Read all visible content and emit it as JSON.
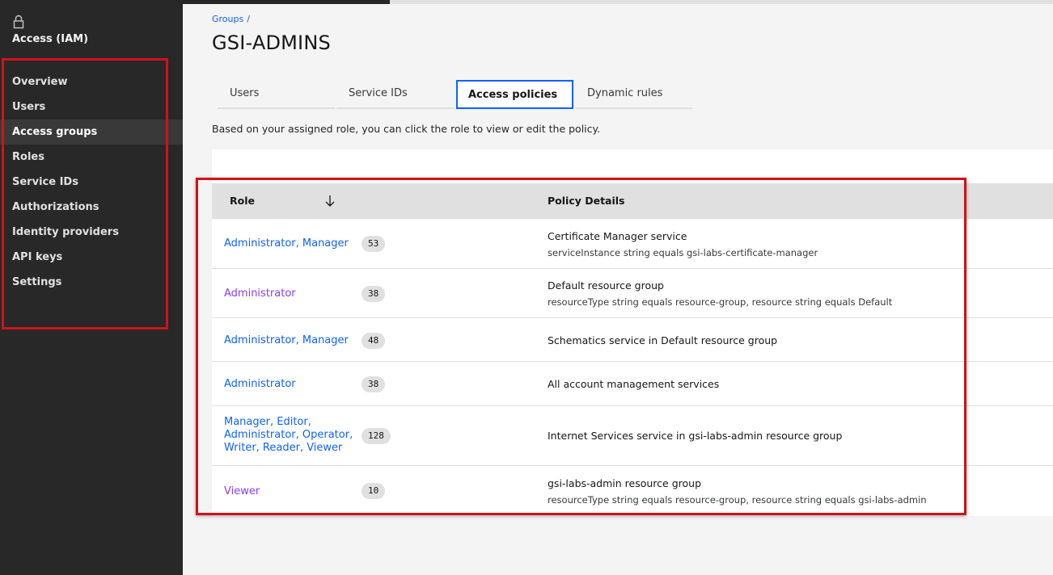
{
  "sidebar": {
    "icon": "lock-icon",
    "title": "Access (IAM)",
    "items": [
      {
        "label": "Overview"
      },
      {
        "label": "Users"
      },
      {
        "label": "Access groups",
        "active": true
      },
      {
        "label": "Roles"
      },
      {
        "label": "Service IDs"
      },
      {
        "label": "Authorizations"
      },
      {
        "label": "Identity providers"
      },
      {
        "label": "API keys"
      },
      {
        "label": "Settings"
      }
    ]
  },
  "breadcrumb": {
    "parent": "Groups",
    "separator": "/"
  },
  "page_title": "GSI-ADMINS",
  "tabs": [
    {
      "label": "Users"
    },
    {
      "label": "Service IDs"
    },
    {
      "label": "Access policies",
      "active": true
    },
    {
      "label": "Dynamic rules"
    }
  ],
  "intro_text": "Based on your assigned role, you can click the role to view or edit the policy.",
  "table": {
    "columns": {
      "role": "Role",
      "details": "Policy Details"
    },
    "sort_icon": "arrow-down-icon",
    "rows": [
      {
        "role": "Administrator, Manager",
        "role_color": "blue",
        "count": "53",
        "detail": "Certificate Manager service",
        "sub": "serviceInstance string equals gsi-labs-certificate-manager"
      },
      {
        "role": "Administrator",
        "role_color": "purple",
        "count": "38",
        "detail": "Default resource group",
        "sub": "resourceType string equals resource-group, resource string equals Default"
      },
      {
        "role": "Administrator, Manager",
        "role_color": "blue",
        "count": "48",
        "detail": "Schematics service in Default resource group",
        "sub": ""
      },
      {
        "role": "Administrator",
        "role_color": "blue",
        "count": "38",
        "detail": "All account management services",
        "sub": ""
      },
      {
        "role_lines": [
          "Manager, Editor,",
          "Administrator, Operator,",
          "Writer, Reader, Viewer"
        ],
        "role_color": "blue",
        "count": "128",
        "detail": "Internet Services service in gsi-labs-admin resource group",
        "sub": ""
      },
      {
        "role": "Viewer",
        "role_color": "purple",
        "count": "10",
        "detail": "gsi-labs-admin resource group",
        "sub": "resourceType string equals resource-group, resource string equals gsi-labs-admin"
      }
    ]
  },
  "colors": {
    "sidebar_bg": "#282828",
    "link_blue": "#0f62fe",
    "link_purple": "#8a3ffc",
    "highlight_red": "#d0121b"
  }
}
